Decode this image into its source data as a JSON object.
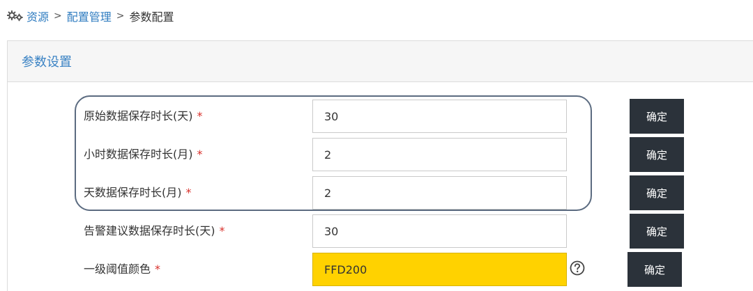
{
  "breadcrumb": {
    "icon": "gears-icon",
    "items": [
      "资源",
      "配置管理",
      "参数配置"
    ],
    "separator": ">"
  },
  "panel": {
    "title": "参数设置"
  },
  "colors": {
    "link": "#2f7cc0",
    "title": "#3b83c4",
    "required": "#d9302b",
    "button_bg": "#2b323a",
    "threshold_color": "#FFD200"
  },
  "rows": [
    {
      "label": "原始数据保存时长(天)",
      "required": "*",
      "value": "30",
      "button": "确定"
    },
    {
      "label": "小时数据保存时长(月)",
      "required": "*",
      "value": "2",
      "button": "确定"
    },
    {
      "label": "天数据保存时长(月)",
      "required": "*",
      "value": "2",
      "button": "确定"
    },
    {
      "label": "告警建议数据保存时长(天)",
      "required": "*",
      "value": "30",
      "button": "确定"
    },
    {
      "label": "一级阈值颜色",
      "required": "*",
      "value": "FFD200",
      "button": "确定",
      "help_icon": "question-circle-icon"
    }
  ]
}
